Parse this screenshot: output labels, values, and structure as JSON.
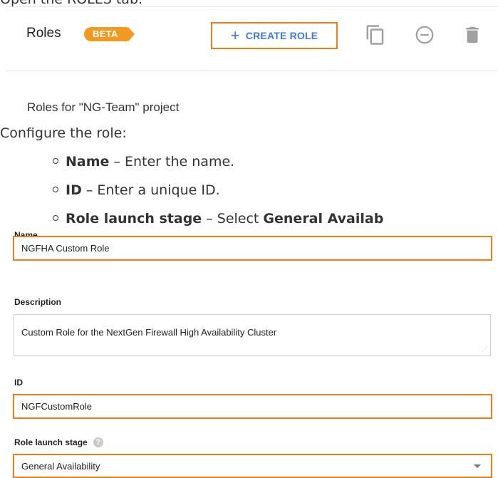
{
  "top_crop_text": "Open the ROLES tab.",
  "roles_header": {
    "title": "Roles",
    "badge": "BETA",
    "create_button_label": "CREATE ROLE",
    "project_caption": "Roles for \"NG-Team\" project"
  },
  "doc": {
    "configure_text": "Configure the role:",
    "bullets": [
      {
        "bold": "Name",
        "rest": " – Enter the name."
      },
      {
        "bold": "ID",
        "rest": " – Enter a unique ID."
      },
      {
        "bold": "Role launch stage",
        "rest": " – Select ",
        "bold2": "General Availab"
      }
    ]
  },
  "form": {
    "name_label": "Name",
    "name_value": "NGFHA Custom Role",
    "description_label": "Description",
    "description_value": "Custom Role for the NextGen Firewall High Availability Cluster",
    "id_label": "ID",
    "id_value": "NGFCustomRole",
    "stage_label": "Role launch stage",
    "stage_value": "General Availability"
  },
  "colors": {
    "highlight": "#f07c19",
    "badge": "#f29a1f",
    "link_blue": "#3b78e7",
    "icon_gray": "#9e9e9e"
  },
  "icons": [
    "plus-icon",
    "copy-icon",
    "disable-icon",
    "delete-icon",
    "help-icon",
    "dropdown-caret-icon"
  ]
}
